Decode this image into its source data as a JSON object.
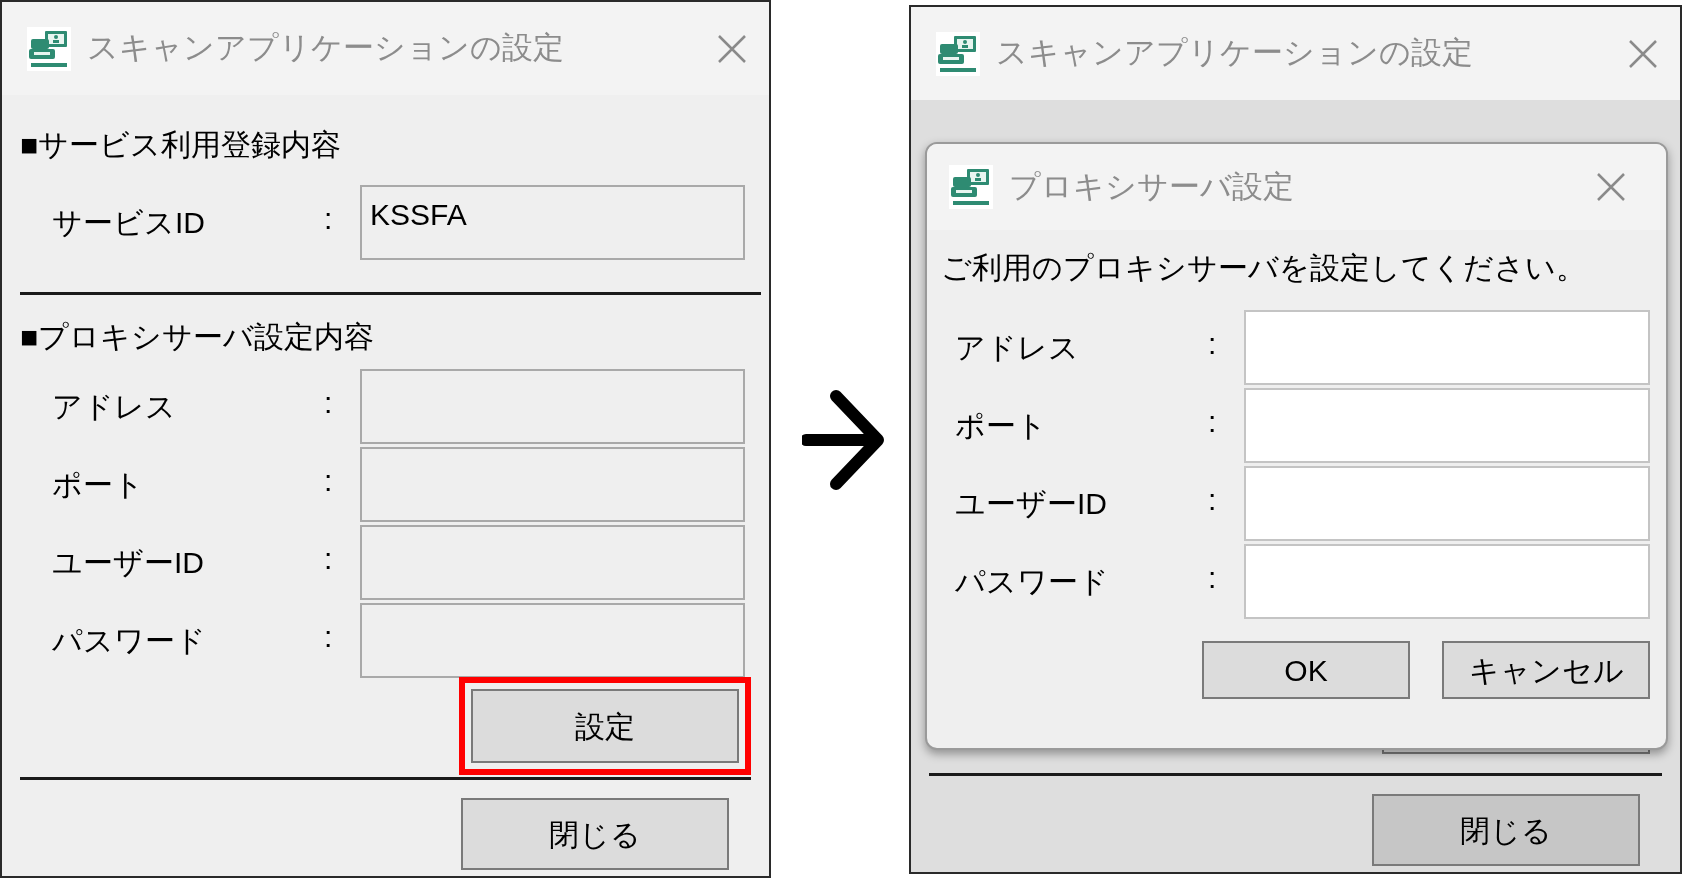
{
  "screens": [
    {
      "window": {
        "title": "スキャンアプリケーションの設定"
      },
      "sections": [
        {
          "heading": "■サービス利用登録内容",
          "fields": [
            {
              "label": "サービスID",
              "separator": ":",
              "value": "KSSFA",
              "readonly": true
            }
          ]
        },
        {
          "heading": "■プロキシサーバ設定内容",
          "fields": [
            {
              "label": "アドレス",
              "separator": ":",
              "readonly": true
            },
            {
              "label": "ポート",
              "separator": ":",
              "readonly": true
            },
            {
              "label": "ユーザーID",
              "separator": ":",
              "readonly": true
            },
            {
              "label": "パスワード",
              "separator": ":",
              "readonly": true
            }
          ]
        }
      ],
      "settings_button": {
        "label": "設定",
        "highlighted": true
      },
      "close_button": "閉じる",
      "dimmed": false
    },
    {
      "window": {
        "title": "スキャンアプリケーションの設定"
      },
      "settings_button": {
        "highlighted": false
      },
      "close_button": "閉じる",
      "dimmed": true,
      "dialog": {
        "title": "プロキシサーバ設定",
        "message": "ご利用のプロキシサーバを設定してください。",
        "fields": [
          {
            "label": "アドレス",
            "separator": ":",
            "readonly": false
          },
          {
            "label": "ポート",
            "separator": ":",
            "readonly": false
          },
          {
            "label": "ユーザーID",
            "separator": ":",
            "readonly": false
          },
          {
            "label": "パスワード",
            "separator": ":",
            "readonly": false
          }
        ],
        "buttons": [
          "OK",
          "キャンセル"
        ]
      }
    }
  ]
}
